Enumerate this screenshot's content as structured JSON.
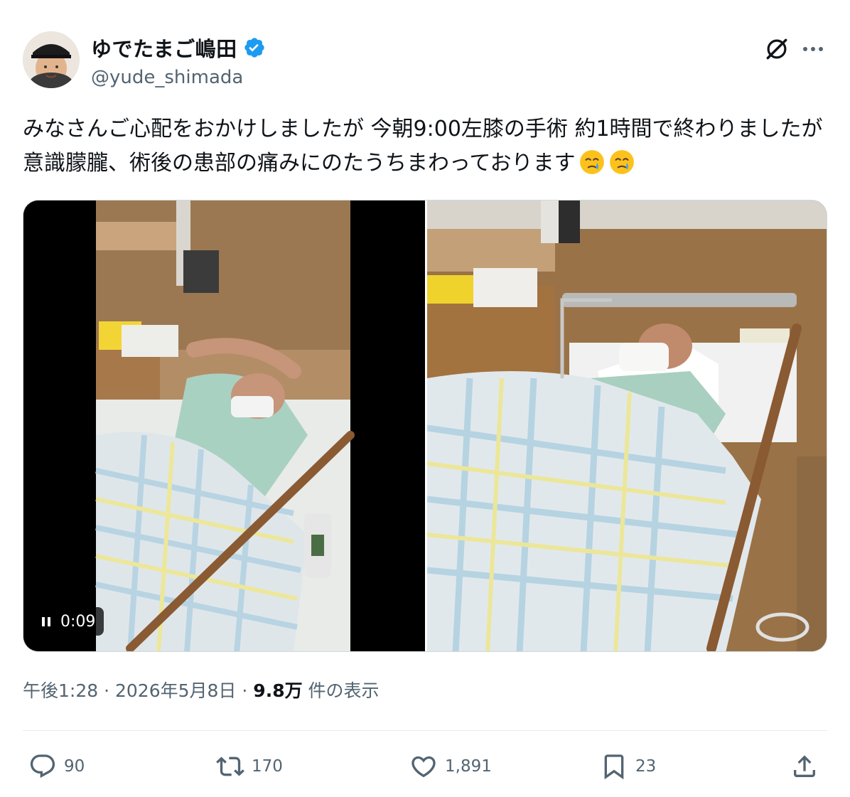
{
  "author": {
    "display_name": "ゆでたまご嶋田",
    "handle": "@yude_shimada",
    "verified_color": "#1d9bf0"
  },
  "tweet": {
    "text": "みなさんご心配をおかけしましたが 今朝9:00左膝の手術 約1時間で終わりましたが 意識朦朧、術後の患部の痛みにのたうちまわっております",
    "emoji": [
      "face-holding-back-tears",
      "face-holding-back-tears"
    ]
  },
  "media": {
    "video_time": "0:09",
    "video_state_icon": "pause-icon"
  },
  "meta": {
    "time": "午後1:28",
    "sep1": "·",
    "date": "2026年5月8日",
    "sep2": "·",
    "views_count": "9.8万",
    "views_label": "件の表示"
  },
  "actions": {
    "replies": "90",
    "reposts": "170",
    "likes": "1,891",
    "bookmarks": "23"
  },
  "colors": {
    "text": "#0f1419",
    "secondary": "#536471",
    "accent": "#1d9bf0"
  }
}
